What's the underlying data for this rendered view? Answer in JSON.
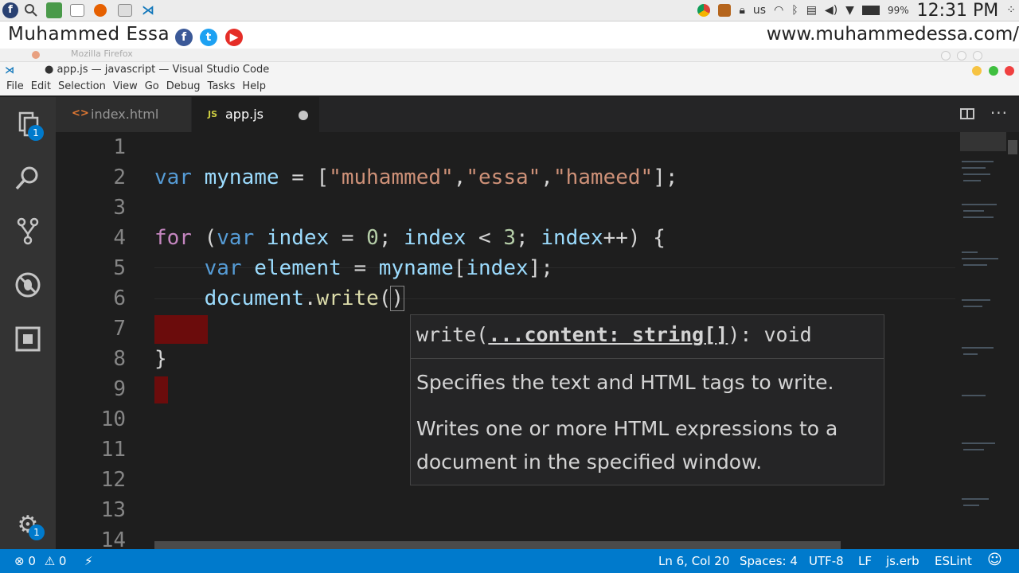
{
  "system": {
    "keyboard_layout": "us",
    "battery": "99%",
    "clock": "12:31 PM"
  },
  "branding": {
    "name": "Muhammed Essa",
    "url": "www.muhammedessa.com/"
  },
  "background_window": {
    "title": "Mozilla Firefox"
  },
  "window": {
    "title": "● app.js — javascript — Visual Studio Code"
  },
  "menu": [
    "File",
    "Edit",
    "Selection",
    "View",
    "Go",
    "Debug",
    "Tasks",
    "Help"
  ],
  "activity_bar": {
    "explorer_badge": "1",
    "settings_badge": "1"
  },
  "tabs": [
    {
      "label": "index.html",
      "icon": "<>"
    },
    {
      "label": "app.js",
      "icon": "JS"
    }
  ],
  "editor": {
    "line_numbers": [
      "1",
      "2",
      "3",
      "4",
      "5",
      "6",
      "7",
      "8",
      "9",
      "10",
      "11",
      "12",
      "13",
      "14"
    ]
  },
  "hover": {
    "sig_name": "write(",
    "sig_param": "...content: string[]",
    "sig_tail": "): void",
    "desc1": "Specifies the text and HTML tags to write.",
    "desc2": "Writes one or more HTML expressions to a document in the specified window."
  },
  "status": {
    "errors": "0",
    "warnings": "0",
    "position": "Ln 6, Col 20",
    "spaces": "Spaces: 4",
    "encoding": "UTF-8",
    "eol": "LF",
    "language": "js.erb",
    "linter": "ESLint"
  },
  "colors": {
    "accent": "#007acc",
    "editor_bg": "#1e1e1e",
    "keyword": "#569cd6",
    "string": "#ce9178",
    "error_block": "#6b0c0c"
  }
}
